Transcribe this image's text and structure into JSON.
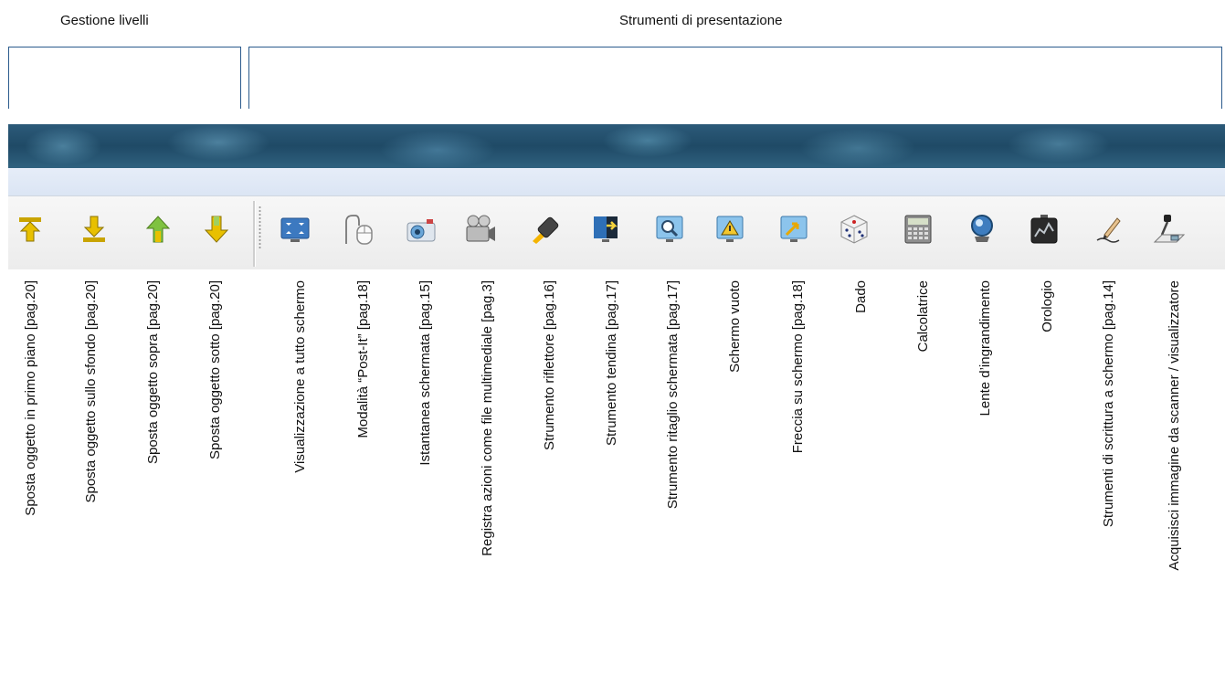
{
  "groups": {
    "levels": "Gestione livelli",
    "presentation": "Strumenti di presentazione"
  },
  "toolbar_items": [
    {
      "label": "Sposta oggetto in primo piano [pag.20]",
      "icon": "bring-to-front-icon"
    },
    {
      "label": "Sposta oggetto sullo sfondo [pag.20]",
      "icon": "send-to-back-icon"
    },
    {
      "label": "Sposta oggetto sopra [pag.20]",
      "icon": "bring-forward-icon"
    },
    {
      "label": "Sposta oggetto sotto [pag.20]",
      "icon": "send-backward-icon"
    },
    {
      "label": "Visualizzazione a tutto schermo",
      "icon": "fullscreen-icon"
    },
    {
      "label": "Modalità “Post-It”  [pag.18]",
      "icon": "mouse-icon"
    },
    {
      "label": "Istantanea schermata [pag.15]",
      "icon": "camera-icon"
    },
    {
      "label": "Registra azioni come file multimediale [pag.3]",
      "icon": "video-camera-icon"
    },
    {
      "label": "Strumento riflettore [pag.16]",
      "icon": "spotlight-icon"
    },
    {
      "label": "Strumento tendina [pag.17]",
      "icon": "curtain-icon"
    },
    {
      "label": "Strumento ritaglio schermata [pag.17]",
      "icon": "screen-crop-icon"
    },
    {
      "label": "Schermo vuoto",
      "icon": "blank-screen-icon"
    },
    {
      "label": "Freccia su schermo [pag.18]",
      "icon": "screen-arrow-icon"
    },
    {
      "label": "Dado",
      "icon": "dice-icon"
    },
    {
      "label": "Calcolatrice",
      "icon": "calculator-icon"
    },
    {
      "label": "Lente d’ingrandimento",
      "icon": "magnifier-icon"
    },
    {
      "label": "Orologio",
      "icon": "clock-icon"
    },
    {
      "label": "Strumenti di scrittura a schermo [pag.14]",
      "icon": "handwriting-icon"
    },
    {
      "label": "Acquisisci immagine da scanner / visualizzatore",
      "icon": "document-camera-icon"
    }
  ]
}
